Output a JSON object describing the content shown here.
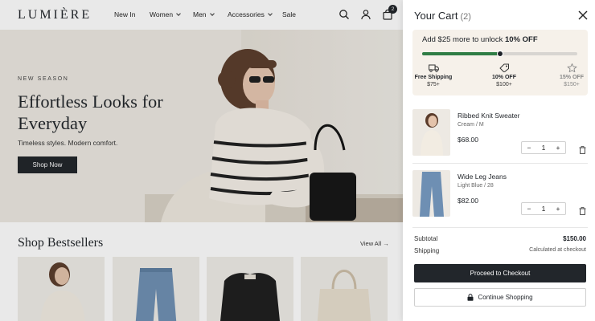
{
  "store": {
    "logo": "LUMIÈRE",
    "nav": [
      {
        "label": "New In"
      },
      {
        "label": "Women"
      },
      {
        "label": "Men"
      },
      {
        "label": "Accessories"
      },
      {
        "label": "Sale"
      }
    ],
    "cart_badge": "2",
    "hero": {
      "eyebrow": "NEW SEASON",
      "title": "Effortless Looks for Everyday",
      "subtitle": "Timeless styles. Modern comfort.",
      "cta": "Shop Now"
    },
    "bestsellers": {
      "title": "Shop Bestsellers",
      "view_all": "View All →"
    }
  },
  "cart": {
    "title": "Your Cart",
    "count": "(2)",
    "promo": {
      "prefix": "Add $25 more to unlock ",
      "bold": "10% OFF",
      "progress": 0.5,
      "tiers": [
        {
          "label": "Free Shipping",
          "value": "$75+",
          "icon": "truck-icon"
        },
        {
          "label": "10% OFF",
          "value": "$100+",
          "icon": "tag-icon"
        },
        {
          "label": "15% OFF",
          "value": "$150+",
          "icon": "star-icon"
        }
      ]
    },
    "items": [
      {
        "name": "Ribbed Knit Sweater",
        "variant": "Cream / M",
        "price": "$68.00",
        "qty": "1"
      },
      {
        "name": "Wide Leg Jeans",
        "variant": "Light Blue / 28",
        "price": "$82.00",
        "qty": "1"
      }
    ],
    "subtotal_label": "Subtotal",
    "subtotal_value": "$150.00",
    "shipping_label": "Shipping",
    "shipping_value": "Calculated at checkout",
    "checkout_label": "Proceed to Checkout",
    "continue_label": "Continue Shopping",
    "accent_color": "#2f7d45"
  }
}
